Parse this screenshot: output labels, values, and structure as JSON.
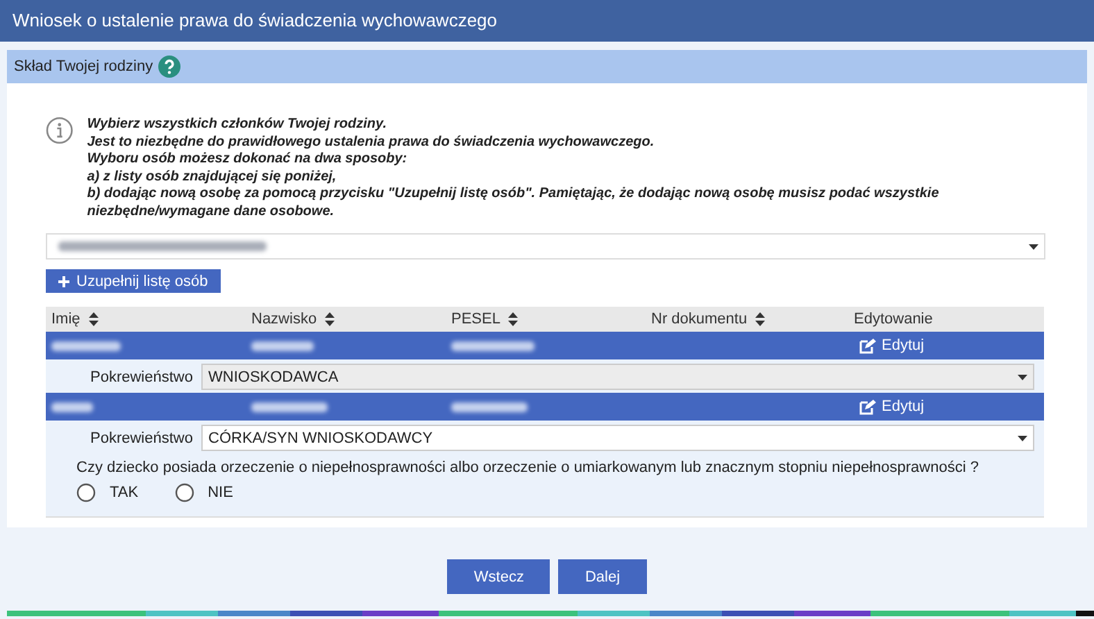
{
  "window": {
    "title": "Wniosek o ustalenie prawa do świadczenia wychowawczego"
  },
  "section": {
    "title": "Skład Twojej rodziny"
  },
  "info": {
    "lines": [
      "Wybierz wszystkich członków Twojej rodziny.",
      "Jest to niezbędne do prawidłowego ustalenia prawa do świadczenia wychowawczego.",
      "Wyboru osób możesz dokonać na dwa sposoby:",
      "a) z listy osób znajdującej się poniżej,",
      "b) dodając nową osobę za pomocą przycisku \"Uzupełnij listę osób\". Pamiętając, że dodając nową osobę musisz podać wszystkie niezbędne/wymagane dane osobowe."
    ]
  },
  "add_button": {
    "label": "Uzupełnij listę osób"
  },
  "table": {
    "columns": [
      {
        "label": "Imię",
        "sortable": true
      },
      {
        "label": "Nazwisko",
        "sortable": true
      },
      {
        "label": "PESEL",
        "sortable": true
      },
      {
        "label": "Nr dokumentu",
        "sortable": true
      },
      {
        "label": "Edytowanie",
        "sortable": false
      }
    ],
    "rows": [
      {
        "selected": true,
        "edit_label": "Edytuj",
        "relationship_label": "Pokrewieństwo",
        "relationship": "WNIOSKODAWCA",
        "relationship_disabled": true
      },
      {
        "selected": true,
        "edit_label": "Edytuj",
        "relationship_label": "Pokrewieństwo",
        "relationship": "CÓRKA/SYN WNIOSKODAWCY",
        "relationship_disabled": false,
        "question": "Czy dziecko posiada orzeczenie o niepełnosprawności albo orzeczenie o umiarkowanym lub znacznym stopniu niepełnosprawności ?",
        "options": [
          {
            "label": "TAK",
            "selected": false
          },
          {
            "label": "NIE",
            "selected": false
          }
        ]
      }
    ]
  },
  "buttons": [
    {
      "label": "Wstecz"
    },
    {
      "label": "Dalej"
    }
  ]
}
